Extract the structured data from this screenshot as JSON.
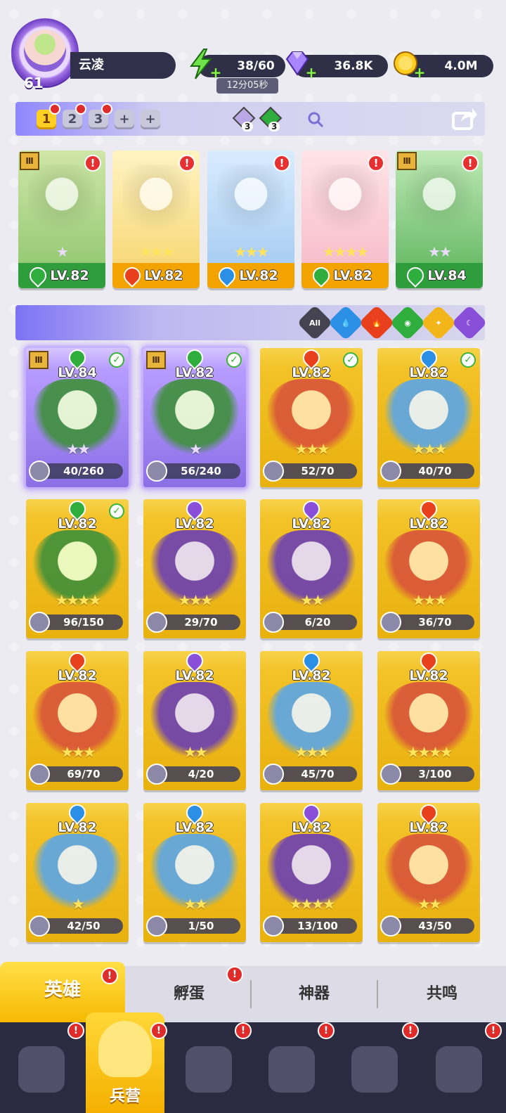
{
  "player": {
    "level": "61",
    "name": "云凌"
  },
  "resources": {
    "stamina": "38/60",
    "stamina_timer": "12分05秒",
    "gems": "36.8K",
    "gold": "4.0M"
  },
  "team_tabs": [
    {
      "label": "1",
      "active": true
    },
    {
      "label": "2",
      "active": false
    },
    {
      "label": "3",
      "active": false
    },
    {
      "label": "+",
      "active": false
    },
    {
      "label": "+",
      "active": false
    }
  ],
  "team_crystals": {
    "dark_count": "3",
    "nature_count": "3"
  },
  "team_heroes": [
    {
      "level": "LV.82",
      "element": "nature",
      "stars": "★",
      "color": "#2f9d3c"
    },
    {
      "level": "LV.82",
      "element": "fire",
      "stars": "★★★",
      "color": "#f2a300"
    },
    {
      "level": "LV.82",
      "element": "water",
      "stars": "★★★",
      "color": "#f2a300"
    },
    {
      "level": "LV.82",
      "element": "nature",
      "stars": "★★★★",
      "color": "#f2a300"
    },
    {
      "level": "LV.84",
      "element": "nature",
      "stars": "★★",
      "color": "#2f9d3c"
    }
  ],
  "filters": [
    "All",
    "water",
    "fire",
    "nature",
    "light",
    "dark"
  ],
  "heroes": [
    {
      "level": "LV.84",
      "progress": "40/260",
      "stars": "★★",
      "element": "nature",
      "check": true,
      "tier": true
    },
    {
      "level": "LV.82",
      "progress": "56/240",
      "stars": "★",
      "element": "nature",
      "check": true,
      "tier": true
    },
    {
      "level": "LV.82",
      "progress": "52/70",
      "stars": "★★★",
      "element": "fire",
      "check": true,
      "tier": false
    },
    {
      "level": "LV.82",
      "progress": "40/70",
      "stars": "★★★",
      "element": "water",
      "check": true,
      "tier": false
    },
    {
      "level": "LV.82",
      "progress": "96/150",
      "stars": "★★★★",
      "element": "nature",
      "check": true,
      "tier": false
    },
    {
      "level": "LV.82",
      "progress": "29/70",
      "stars": "★★★",
      "element": "dark",
      "check": false,
      "tier": false
    },
    {
      "level": "LV.82",
      "progress": "6/20",
      "stars": "★★",
      "element": "dark",
      "check": false,
      "tier": false
    },
    {
      "level": "LV.82",
      "progress": "36/70",
      "stars": "★★★",
      "element": "fire",
      "check": false,
      "tier": false
    },
    {
      "level": "LV.82",
      "progress": "69/70",
      "stars": "★★★",
      "element": "fire",
      "check": false,
      "tier": false
    },
    {
      "level": "LV.82",
      "progress": "4/20",
      "stars": "★★",
      "element": "dark",
      "check": false,
      "tier": false
    },
    {
      "level": "LV.82",
      "progress": "45/70",
      "stars": "★★★",
      "element": "water",
      "check": false,
      "tier": false
    },
    {
      "level": "LV.82",
      "progress": "3/100",
      "stars": "★★★★",
      "element": "fire",
      "check": false,
      "tier": false
    },
    {
      "level": "LV.82",
      "progress": "42/50",
      "stars": "★",
      "element": "water",
      "check": false,
      "tier": false
    },
    {
      "level": "LV.82",
      "progress": "1/50",
      "stars": "★★",
      "element": "water",
      "check": false,
      "tier": false
    },
    {
      "level": "LV.82",
      "progress": "13/100",
      "stars": "★★★★",
      "element": "dark",
      "check": false,
      "tier": false
    },
    {
      "level": "LV.82",
      "progress": "43/50",
      "stars": "★★",
      "element": "fire",
      "check": false,
      "tier": false
    }
  ],
  "bottom_tabs": [
    {
      "label": "英雄",
      "active": true
    },
    {
      "label": "孵蛋",
      "active": false
    },
    {
      "label": "神器",
      "active": false
    },
    {
      "label": "共鸣",
      "active": false
    }
  ],
  "nav": {
    "active_label": "兵营"
  },
  "colors": {
    "fire": "#e8401c",
    "water": "#2c8fe6",
    "nature": "#2fae3e",
    "dark": "#8a4fd8",
    "light": "#f2b61a",
    "card_gold": "#f3c227",
    "card_purple": "#b79cff"
  }
}
